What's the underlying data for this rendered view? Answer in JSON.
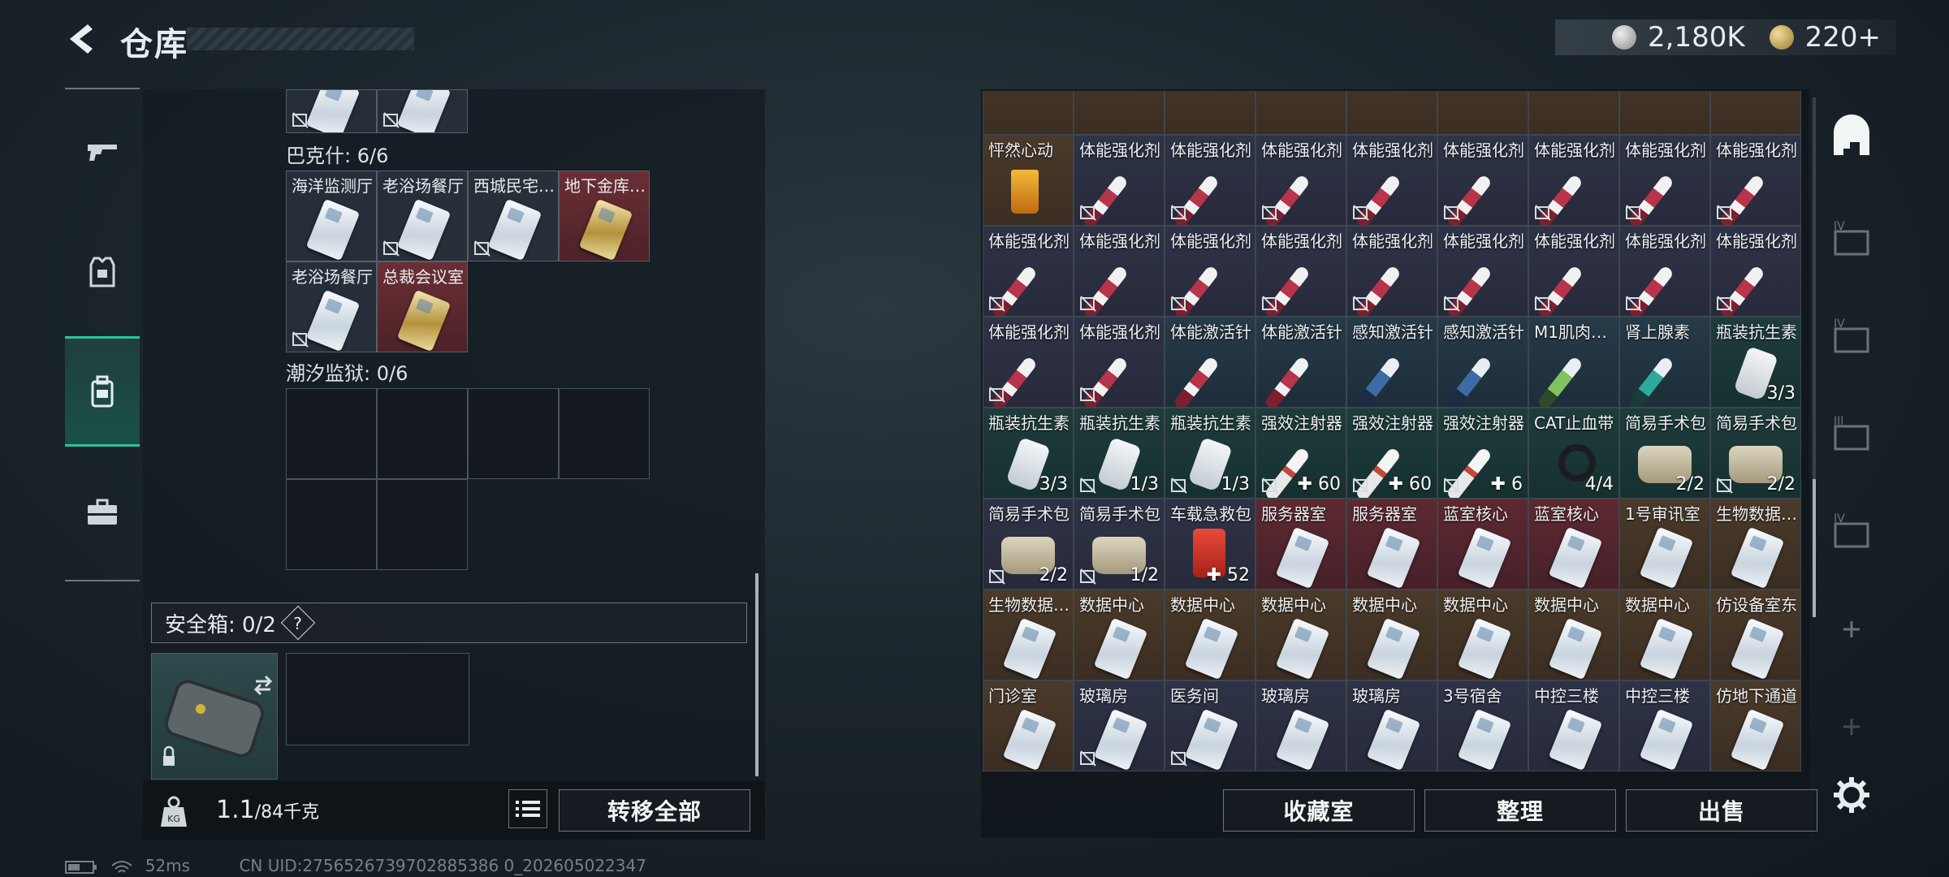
{
  "header": {
    "title": "仓库",
    "currency_silver": "2,180K",
    "currency_gold": "220+"
  },
  "left_rail": {
    "items": [
      "weapon",
      "armor",
      "backpack",
      "case"
    ],
    "active": 2
  },
  "stash": {
    "top_stub": {
      "cells": [
        "",
        ""
      ]
    },
    "section_bakeshi": {
      "label": "巴克什: 6/6",
      "row1": [
        "海洋监测厅",
        "老浴场餐厅",
        "西城民宅…",
        "地下金库…"
      ],
      "row2": [
        "老浴场餐厅",
        "总裁会议室"
      ]
    },
    "section_chaoxi": {
      "label": "潮汐监狱: 0/6"
    }
  },
  "safe": {
    "label": "安全箱: 0/2",
    "help": "?"
  },
  "left_bottom": {
    "weight_current": "1.1",
    "weight_max": "/84千克",
    "transfer_all": "转移全部"
  },
  "grid": {
    "rows": [
      [
        {
          "name": "怦然心动",
          "icon": "drink",
          "bg": "brown",
          "count": ""
        },
        {
          "name": "体能强化剂",
          "icon": "syringe-red",
          "bg": "purple",
          "count": "",
          "slot": true
        },
        {
          "name": "体能强化剂",
          "icon": "syringe-red",
          "bg": "purple",
          "count": "",
          "slot": true
        },
        {
          "name": "体能强化剂",
          "icon": "syringe-red",
          "bg": "purple",
          "count": "",
          "slot": true
        },
        {
          "name": "体能强化剂",
          "icon": "syringe-red",
          "bg": "purple",
          "count": "",
          "slot": true
        },
        {
          "name": "体能强化剂",
          "icon": "syringe-red",
          "bg": "purple",
          "count": "",
          "slot": true
        },
        {
          "name": "体能强化剂",
          "icon": "syringe-red",
          "bg": "purple",
          "count": "",
          "slot": true
        },
        {
          "name": "体能强化剂",
          "icon": "syringe-red",
          "bg": "purple",
          "count": "",
          "slot": true
        },
        {
          "name": "体能强化剂",
          "icon": "syringe-red",
          "bg": "purple",
          "count": "",
          "slot": true
        }
      ],
      [
        {
          "name": "体能强化剂",
          "icon": "syringe-red",
          "bg": "purple",
          "count": "",
          "slot": true
        },
        {
          "name": "体能强化剂",
          "icon": "syringe-red",
          "bg": "purple",
          "count": "",
          "slot": true
        },
        {
          "name": "体能强化剂",
          "icon": "syringe-red",
          "bg": "purple",
          "count": "",
          "slot": true
        },
        {
          "name": "体能强化剂",
          "icon": "syringe-red",
          "bg": "purple",
          "count": "",
          "slot": true
        },
        {
          "name": "体能强化剂",
          "icon": "syringe-red",
          "bg": "purple",
          "count": "",
          "slot": true
        },
        {
          "name": "体能强化剂",
          "icon": "syringe-red",
          "bg": "purple",
          "count": "",
          "slot": true
        },
        {
          "name": "体能强化剂",
          "icon": "syringe-red",
          "bg": "purple",
          "count": "",
          "slot": true
        },
        {
          "name": "体能强化剂",
          "icon": "syringe-red",
          "bg": "purple",
          "count": "",
          "slot": true
        },
        {
          "name": "体能强化剂",
          "icon": "syringe-red",
          "bg": "purple",
          "count": "",
          "slot": true
        }
      ],
      [
        {
          "name": "体能强化剂",
          "icon": "syringe-red",
          "bg": "purple",
          "count": "",
          "slot": true
        },
        {
          "name": "体能强化剂",
          "icon": "syringe-red",
          "bg": "purple",
          "count": "",
          "slot": true
        },
        {
          "name": "体能激活针",
          "icon": "syringe-red",
          "bg": "steel",
          "count": ""
        },
        {
          "name": "体能激活针",
          "icon": "syringe-red",
          "bg": "steel",
          "count": ""
        },
        {
          "name": "感知激活针",
          "icon": "syringe-blue",
          "bg": "steel",
          "count": ""
        },
        {
          "name": "感知激活针",
          "icon": "syringe-blue",
          "bg": "steel",
          "count": ""
        },
        {
          "name": "M1肌肉…",
          "icon": "syringe-green",
          "bg": "steel",
          "count": ""
        },
        {
          "name": "肾上腺素",
          "icon": "syringe-teal",
          "bg": "steel",
          "count": ""
        },
        {
          "name": "瓶装抗生素",
          "icon": "bottle",
          "bg": "teal",
          "count": "3/3"
        }
      ],
      [
        {
          "name": "瓶装抗生素",
          "icon": "bottle",
          "bg": "teal",
          "count": "3/3"
        },
        {
          "name": "瓶装抗生素",
          "icon": "bottle",
          "bg": "teal",
          "count": "1/3",
          "slot": true
        },
        {
          "name": "瓶装抗生素",
          "icon": "bottle",
          "bg": "teal",
          "count": "1/3",
          "slot": true
        },
        {
          "name": "强效注射器",
          "icon": "syringe-white",
          "bg": "teal",
          "count": "✚ 60",
          "slot": true
        },
        {
          "name": "强效注射器",
          "icon": "syringe-white",
          "bg": "teal",
          "count": "✚ 60",
          "slot": true
        },
        {
          "name": "强效注射器",
          "icon": "syringe-white",
          "bg": "teal",
          "count": "✚ 6",
          "slot": true
        },
        {
          "name": "CAT止血带",
          "icon": "tourniquet",
          "bg": "teal",
          "count": "4/4"
        },
        {
          "name": "简易手术包",
          "icon": "bag",
          "bg": "teal",
          "count": "2/2"
        },
        {
          "name": "简易手术包",
          "icon": "bag",
          "bg": "teal",
          "count": "2/2",
          "slot": true
        }
      ],
      [
        {
          "name": "简易手术包",
          "icon": "bag",
          "bg": "purple",
          "count": "2/2",
          "slot": true
        },
        {
          "name": "简易手术包",
          "icon": "bag",
          "bg": "purple",
          "count": "1/2",
          "slot": true
        },
        {
          "name": "车载急救包",
          "icon": "redbag",
          "bg": "purple",
          "count": "✚ 52"
        },
        {
          "name": "服务器室",
          "icon": "card",
          "bg": "red",
          "count": ""
        },
        {
          "name": "服务器室",
          "icon": "card",
          "bg": "red",
          "count": ""
        },
        {
          "name": "蓝室核心",
          "icon": "card",
          "bg": "red",
          "count": ""
        },
        {
          "name": "蓝室核心",
          "icon": "card",
          "bg": "red",
          "count": ""
        },
        {
          "name": "1号审讯室",
          "icon": "card",
          "bg": "brown",
          "count": ""
        },
        {
          "name": "生物数据…",
          "icon": "card",
          "bg": "brown",
          "count": ""
        }
      ],
      [
        {
          "name": "生物数据…",
          "icon": "card",
          "bg": "brown",
          "count": ""
        },
        {
          "name": "数据中心",
          "icon": "card",
          "bg": "brown",
          "count": ""
        },
        {
          "name": "数据中心",
          "icon": "card",
          "bg": "brown",
          "count": ""
        },
        {
          "name": "数据中心",
          "icon": "card",
          "bg": "brown",
          "count": ""
        },
        {
          "name": "数据中心",
          "icon": "card",
          "bg": "brown",
          "count": ""
        },
        {
          "name": "数据中心",
          "icon": "card",
          "bg": "brown",
          "count": ""
        },
        {
          "name": "数据中心",
          "icon": "card",
          "bg": "brown",
          "count": ""
        },
        {
          "name": "数据中心",
          "icon": "card",
          "bg": "brown",
          "count": ""
        },
        {
          "name": "仿设备室东",
          "icon": "card",
          "bg": "brown",
          "count": ""
        }
      ],
      [
        {
          "name": "门诊室",
          "icon": "card",
          "bg": "brown",
          "count": ""
        },
        {
          "name": "玻璃房",
          "icon": "card",
          "bg": "purple",
          "count": "",
          "slot": true
        },
        {
          "name": "医务间",
          "icon": "card",
          "bg": "purple",
          "count": "",
          "slot": true
        },
        {
          "name": "玻璃房",
          "icon": "card",
          "bg": "purple",
          "count": ""
        },
        {
          "name": "玻璃房",
          "icon": "card",
          "bg": "purple",
          "count": ""
        },
        {
          "name": "3号宿舍",
          "icon": "card",
          "bg": "purple",
          "count": ""
        },
        {
          "name": "中控三楼",
          "icon": "card",
          "bg": "purple",
          "count": ""
        },
        {
          "name": "中控三楼",
          "icon": "card",
          "bg": "purple",
          "count": ""
        },
        {
          "name": "仿地下通道",
          "icon": "card",
          "bg": "brown",
          "count": ""
        }
      ]
    ]
  },
  "right_bottom": {
    "collection": "收藏室",
    "sort": "整理",
    "sell": "出售"
  },
  "right_rail": {
    "items": [
      "home-icon",
      "IV",
      "IV",
      "III",
      "IV",
      "+",
      "+"
    ]
  },
  "status": {
    "ping": "52ms",
    "uid": "CN UID:2756526739702885386 0_202605022347"
  }
}
